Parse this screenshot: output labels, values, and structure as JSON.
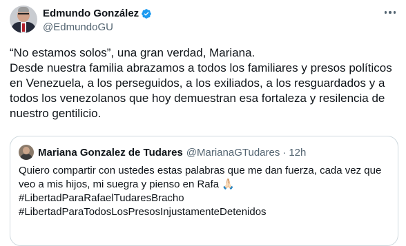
{
  "author": {
    "display_name": "Edmundo González",
    "handle": "@EdmundoGU",
    "avatar_icon": "profile-photo-man-suit",
    "verified_icon": "verified-badge-icon",
    "verified_color": "#1d9bf0"
  },
  "menu_icon": "more-horizontal-icon",
  "tweet": {
    "text": "“No estamos solos”, una gran verdad, Mariana.\nDesde nuestra familia abrazamos a todos los familiares y presos políticos en Venezuela, a los perseguidos, a los exiliados, a los resguardados y a todos los venezolanos que hoy demuestran esa fortaleza y resilencia de nuestro gentilicio."
  },
  "quoted_tweet": {
    "display_name": "Mariana Gonzalez de Tudares",
    "handle": "@MarianaGTudares",
    "separator": "·",
    "time": "12h",
    "lines": [
      "Quiero compartir con ustedes estas palabras que me dan fuerza, cada vez que",
      "veo a mis hijos, mi suegra y pienso en Rafa 🙏🏻",
      "#LibertadParaRafaelTudaresBracho",
      "#LibertadParaTodosLosPresosInjustamenteDetenidos"
    ]
  },
  "colors": {
    "text": "#0f1419",
    "secondary": "#536471",
    "border": "#cfd9de"
  }
}
